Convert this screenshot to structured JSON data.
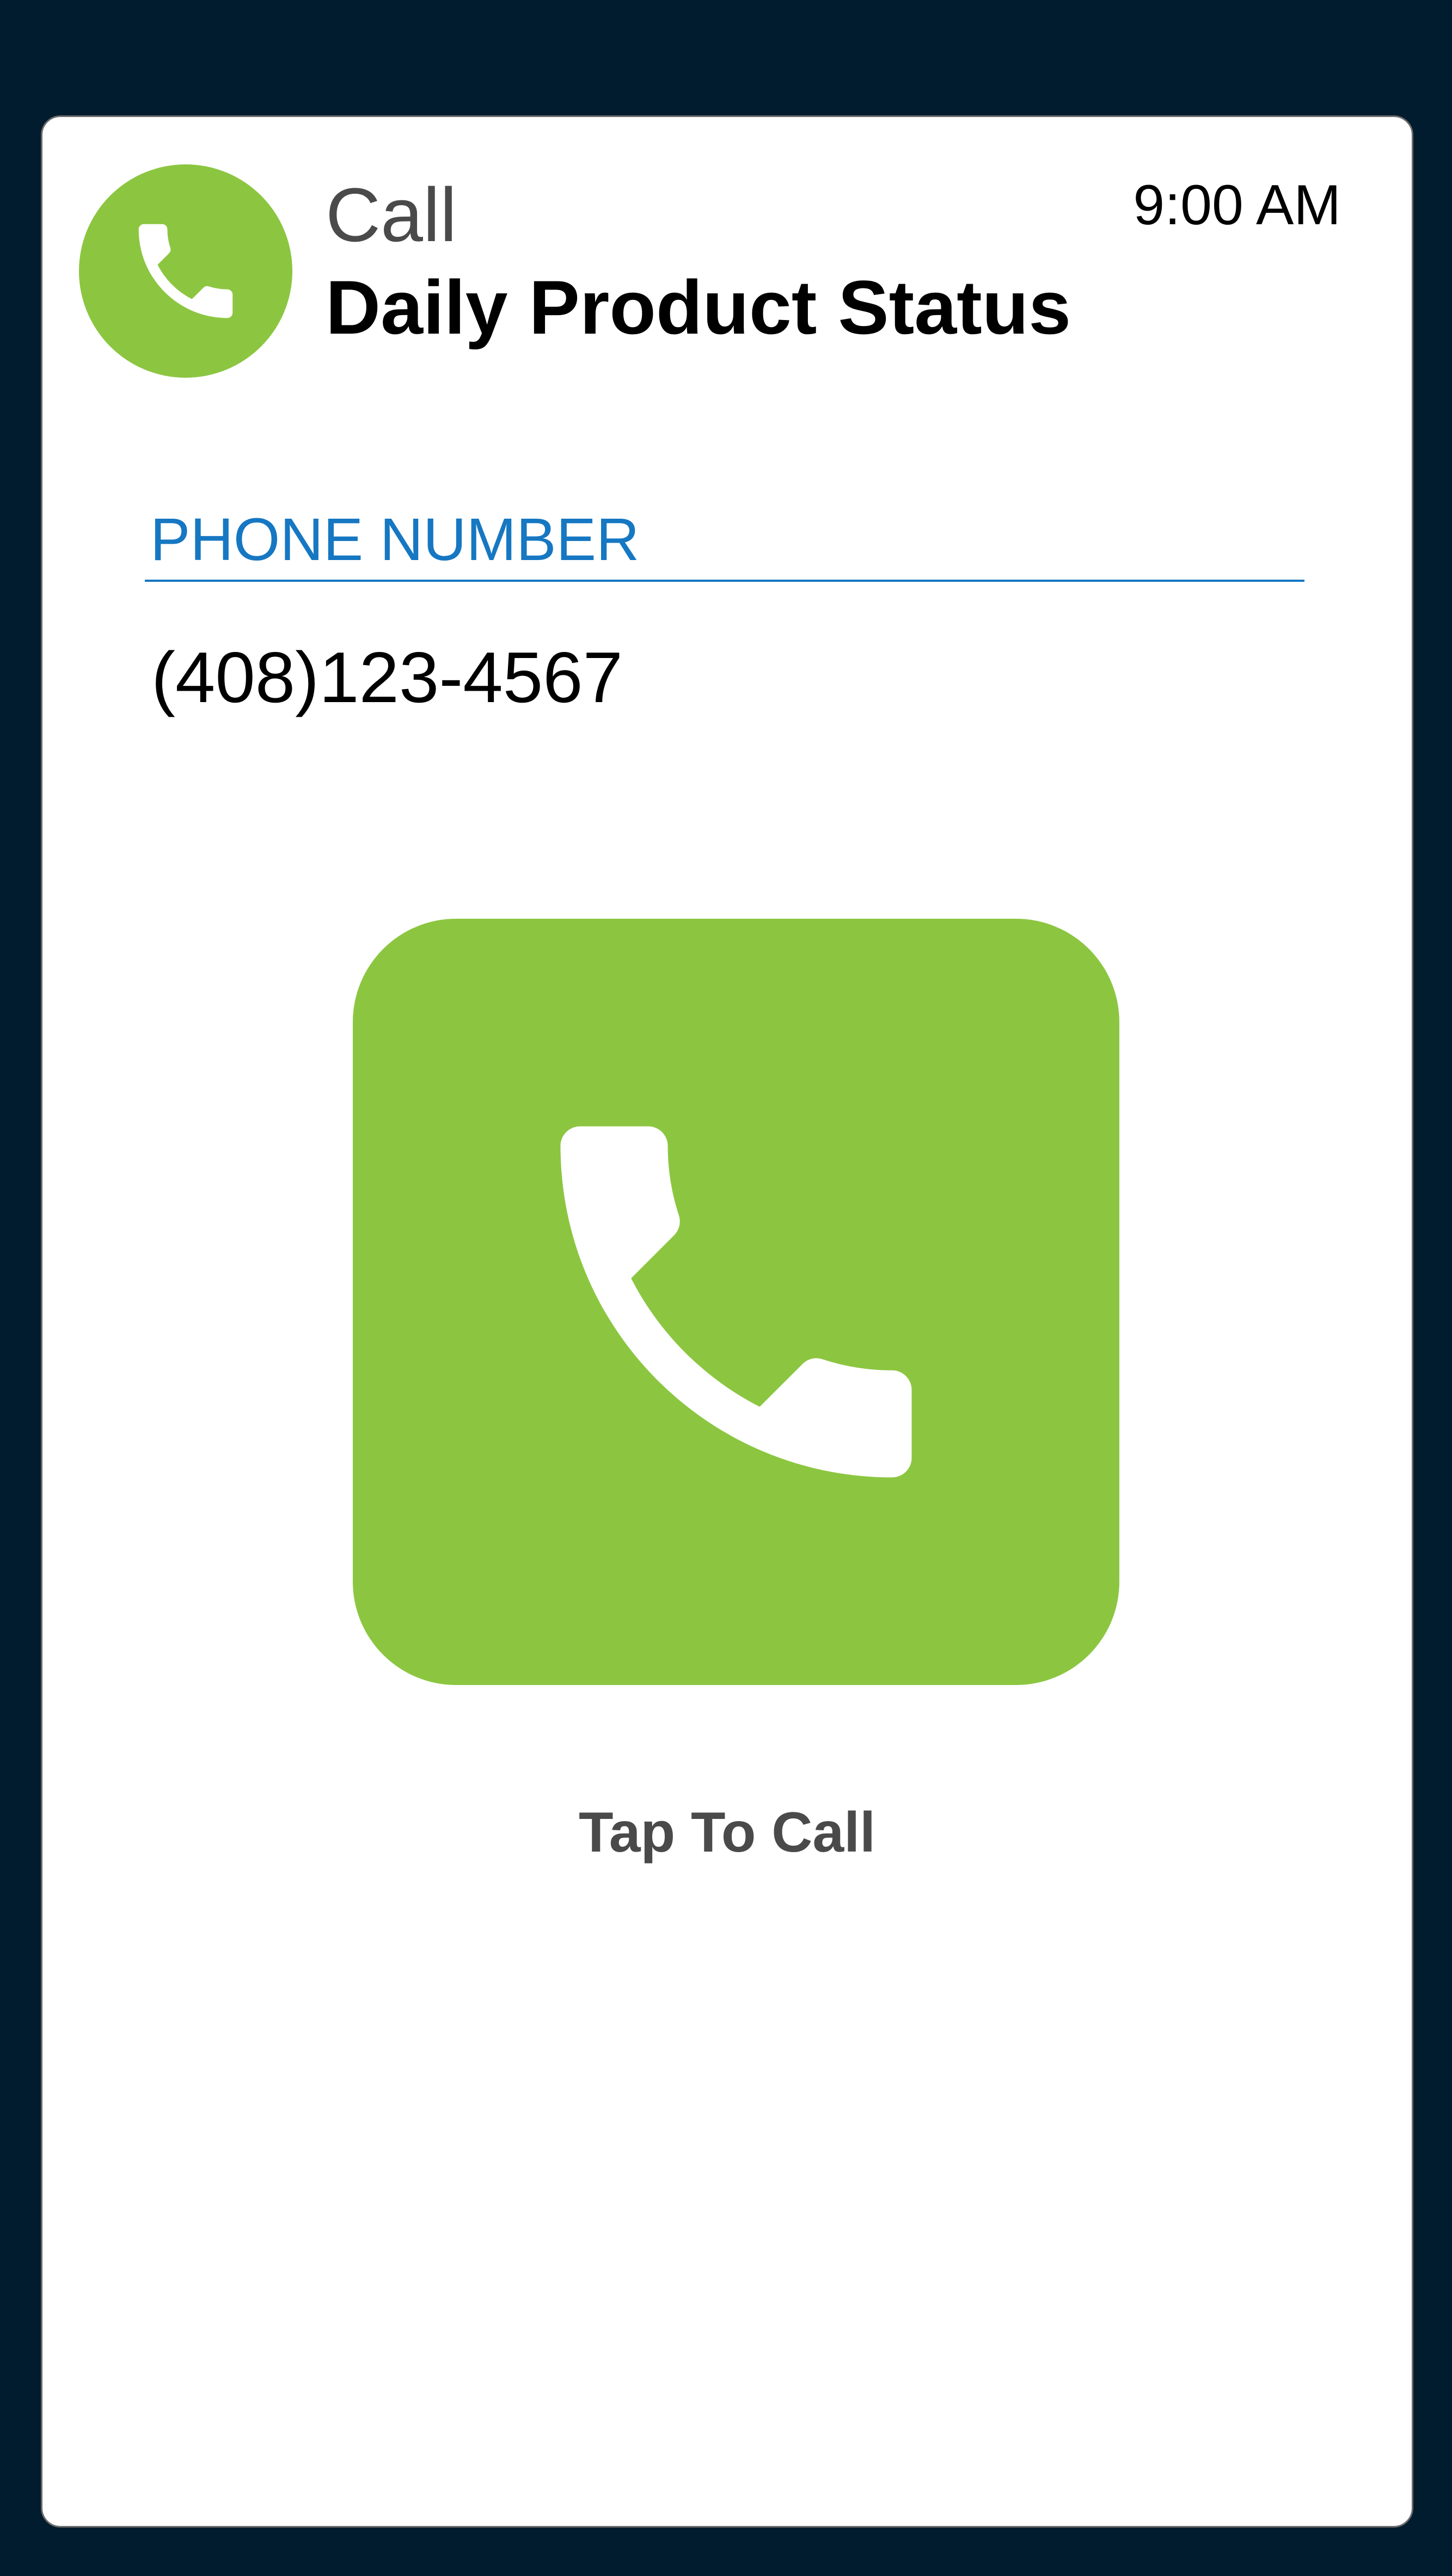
{
  "header": {
    "icon": "phone-icon",
    "kind": "Call",
    "title": "Daily Product Status",
    "time": "9:00 AM"
  },
  "phone_field": {
    "label": "PHONE NUMBER",
    "value": "(408)123-4567"
  },
  "call_action": {
    "icon": "phone-icon",
    "label": "Tap To Call"
  },
  "colors": {
    "background": "#001c2e",
    "card": "#ffffff",
    "accent_green": "#8cc641",
    "label_blue": "#1677c2",
    "text_dark": "#000000",
    "text_gray": "#4a4a4a"
  }
}
